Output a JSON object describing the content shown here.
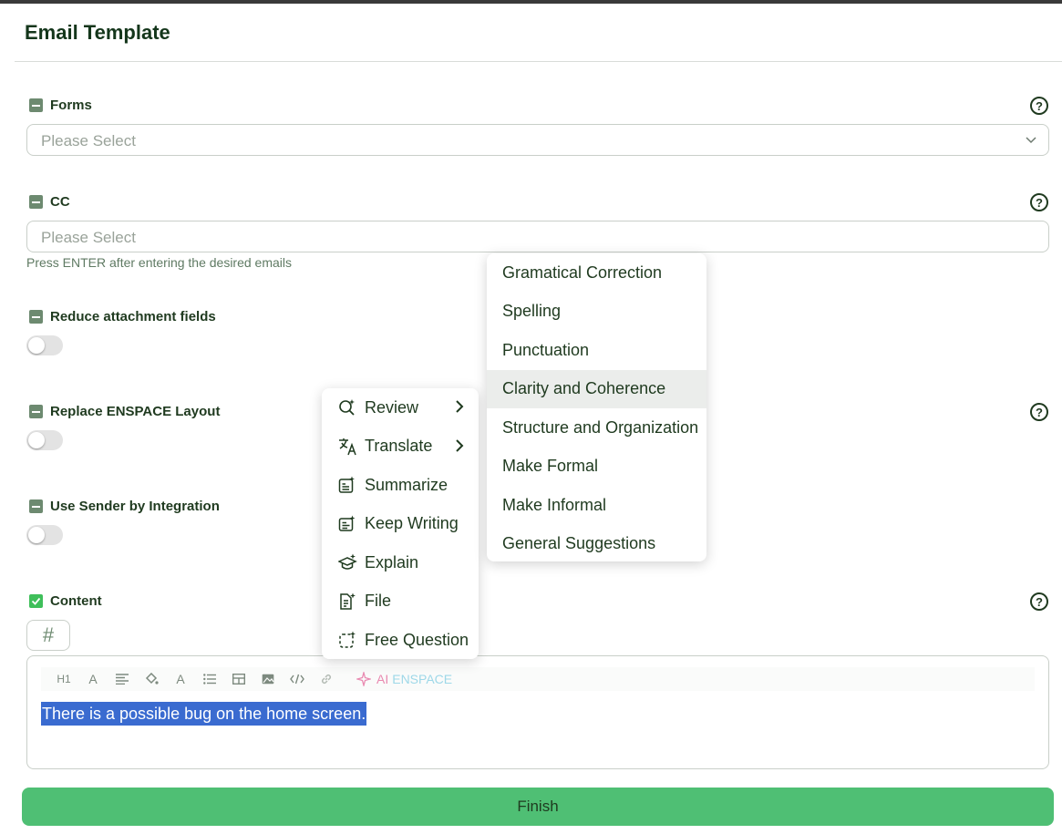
{
  "modal": {
    "title": "Email Template"
  },
  "forms": {
    "label": "Forms",
    "placeholder": "Please Select"
  },
  "cc": {
    "label": "CC",
    "placeholder": "Please Select",
    "hint": "Press ENTER after entering the desired emails"
  },
  "reduce_attachment": {
    "label": "Reduce attachment fields",
    "enabled": false
  },
  "replace_layout": {
    "label": "Replace ENSPACE Layout",
    "enabled": false
  },
  "sender_integration": {
    "label": "Use Sender by Integration",
    "enabled": false
  },
  "content": {
    "label": "Content",
    "hash_symbol": "#",
    "toolbar": {
      "h1": "H1",
      "font": "A",
      "font_color": "A",
      "ai_label": "AI",
      "ai_brand": "ENSPACE"
    },
    "text": "There is a possible bug on the home screen."
  },
  "ai_menu": {
    "items": [
      {
        "label": "Review",
        "icon": "review-sparkle-icon",
        "submenu": true
      },
      {
        "label": "Translate",
        "icon": "translate-icon",
        "submenu": true
      },
      {
        "label": "Summarize",
        "icon": "summarize-icon",
        "submenu": false
      },
      {
        "label": "Keep Writing",
        "icon": "keep-writing-icon",
        "submenu": false
      },
      {
        "label": "Explain",
        "icon": "explain-cap-icon",
        "submenu": false
      },
      {
        "label": "File",
        "icon": "file-sparkle-icon",
        "submenu": false
      },
      {
        "label": "Free Question",
        "icon": "free-question-icon",
        "submenu": false
      }
    ]
  },
  "review_submenu": {
    "items": [
      "Gramatical Correction",
      "Spelling",
      "Punctuation",
      "Clarity and Coherence",
      "Structure and Organization",
      "Make Formal",
      "Make Informal",
      "General Suggestions"
    ],
    "hovered": "Clarity and Coherence"
  },
  "help_symbol": "?",
  "finish_label": "Finish",
  "colors": {
    "primary_green": "#4fbf74",
    "dark_text": "#1f3a1f",
    "selection_blue": "#3a6bd0",
    "checkbox_muted": "#6d8a70",
    "checkbox_checked": "#3fbf5a"
  }
}
